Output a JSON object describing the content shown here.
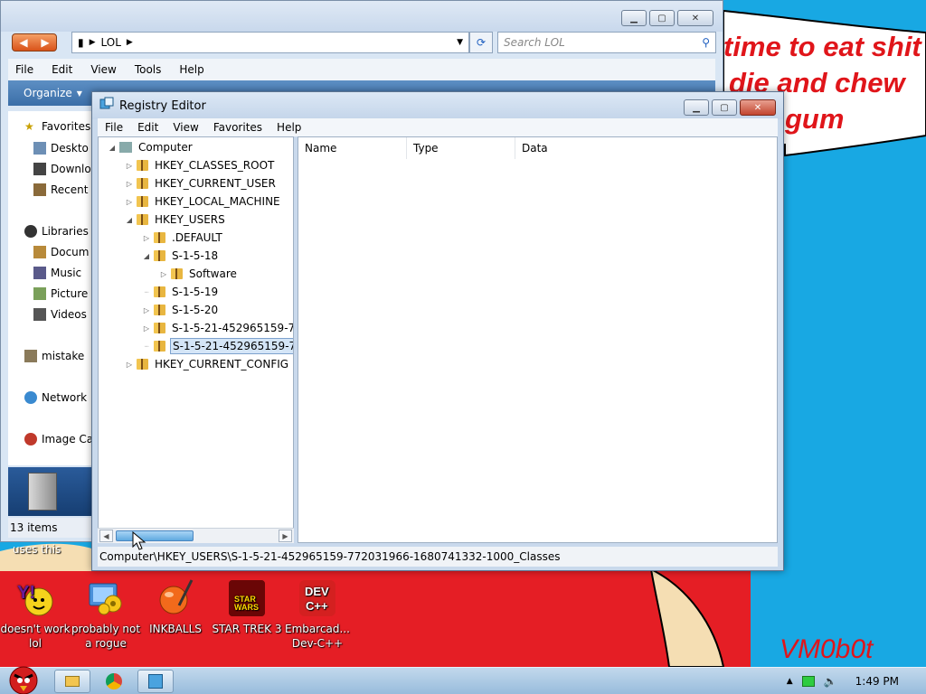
{
  "wallpaper": {
    "lines": [
      "time to eat shit",
      "die and chew",
      "gum"
    ],
    "signature": "VM0b0t",
    "caption": "uses this"
  },
  "desktop_icons": [
    {
      "label": "doesn't work lol"
    },
    {
      "label": "probably not a rogue"
    },
    {
      "label": "INKBALLS"
    },
    {
      "label": "STAR TREK 3"
    },
    {
      "label": "Embarcad... Dev-C++"
    }
  ],
  "explorer": {
    "address_path": "LOL",
    "search_placeholder": "Search LOL",
    "menu": [
      "File",
      "Edit",
      "View",
      "Tools",
      "Help"
    ],
    "toolbar_organize": "Organize",
    "nav": {
      "favorites": "Favorites",
      "desktop": "Deskto",
      "downloads": "Downlo",
      "recent": "Recent",
      "libraries": "Libraries",
      "documents": "Docum",
      "music": "Music",
      "pictures": "Picture",
      "videos": "Videos",
      "homegroup": "mistake",
      "network": "Network",
      "image": "Image Ca"
    },
    "item_count": "13 items"
  },
  "regedit": {
    "title": "Registry Editor",
    "menu": [
      "File",
      "Edit",
      "View",
      "Favorites",
      "Help"
    ],
    "tree": {
      "computer": "Computer",
      "hkcr": "HKEY_CLASSES_ROOT",
      "hkcu": "HKEY_CURRENT_USER",
      "hklm": "HKEY_LOCAL_MACHINE",
      "hku": "HKEY_USERS",
      "default": ".DEFAULT",
      "s18": "S-1-5-18",
      "software": "Software",
      "s19": "S-1-5-19",
      "s20": "S-1-5-20",
      "s21a": "S-1-5-21-452965159-7",
      "s21b": "S-1-5-21-452965159-7",
      "hkcc": "HKEY_CURRENT_CONFIG"
    },
    "columns": [
      "Name",
      "Type",
      "Data"
    ],
    "status_path": "Computer\\HKEY_USERS\\S-1-5-21-452965159-772031966-1680741332-1000_Classes"
  },
  "taskbar": {
    "clock": "1:49 PM"
  }
}
